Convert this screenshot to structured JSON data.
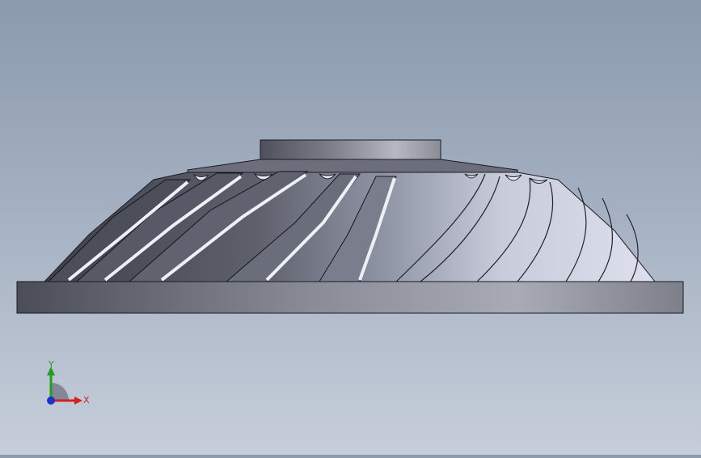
{
  "viewport": {
    "background_top": "#8b9aad",
    "background_bottom": "#c6ceda",
    "model": "impeller",
    "view_orientation": "front"
  },
  "triad": {
    "x_label": "X",
    "y_label": "Y",
    "x_color": "#d42020",
    "y_color": "#20a020",
    "z_color": "#2030c8"
  }
}
